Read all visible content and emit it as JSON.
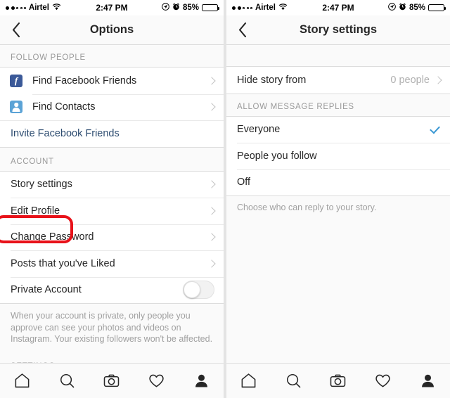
{
  "status_bar": {
    "signal_filled": 2,
    "signal_total": 5,
    "carrier": "Airtel",
    "wifi_icon": "wifi-icon",
    "time": "2:47 PM",
    "location_icon": "location-arrow-icon",
    "alarm_icon": "alarm-clock-icon",
    "battery_percent": "85%",
    "battery_level": 85
  },
  "left_screen": {
    "nav": {
      "back_icon": "chevron-left-icon",
      "title": "Options"
    },
    "sections": [
      {
        "header": "FOLLOW PEOPLE",
        "rows": [
          {
            "label": "Find Facebook Friends",
            "icon": "facebook-icon",
            "accessory": "chevron"
          },
          {
            "label": "Find Contacts",
            "icon": "contacts-icon",
            "accessory": "chevron"
          }
        ],
        "link": "Invite Facebook Friends"
      },
      {
        "header": "ACCOUNT",
        "rows": [
          {
            "label": "Story settings",
            "accessory": "chevron",
            "highlighted": true
          },
          {
            "label": "Edit Profile",
            "accessory": "chevron"
          },
          {
            "label": "Change Password",
            "accessory": "chevron"
          },
          {
            "label": "Posts that you've Liked",
            "accessory": "chevron"
          },
          {
            "label": "Private Account",
            "accessory": "toggle",
            "toggle_on": false
          }
        ],
        "helper": "When your account is private, only people you approve can see your photos and videos on Instagram. Your existing followers won't be affected."
      },
      {
        "header": "SETTINGS",
        "rows": []
      }
    ],
    "annotation": {
      "color": "#e8121a",
      "target": "Story settings"
    }
  },
  "right_screen": {
    "nav": {
      "back_icon": "chevron-left-icon",
      "title": "Story settings"
    },
    "hide_story": {
      "label": "Hide story from",
      "value": "0 people",
      "accessory": "chevron"
    },
    "replies": {
      "header": "ALLOW MESSAGE REPLIES",
      "options": [
        {
          "label": "Everyone",
          "selected": true
        },
        {
          "label": "People you follow",
          "selected": false
        },
        {
          "label": "Off",
          "selected": false
        }
      ],
      "helper": "Choose who can reply to your story.",
      "check_color": "#3897d3"
    }
  },
  "tab_bar": {
    "tabs": [
      {
        "name": "home-icon",
        "active": false
      },
      {
        "name": "search-icon",
        "active": false
      },
      {
        "name": "camera-icon",
        "active": false
      },
      {
        "name": "heart-icon",
        "active": false
      },
      {
        "name": "profile-icon",
        "active": true
      }
    ]
  }
}
